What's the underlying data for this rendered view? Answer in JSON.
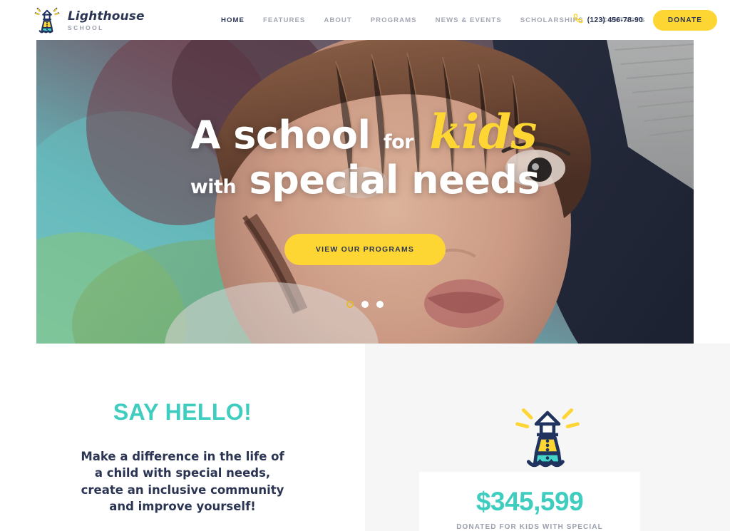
{
  "brand": {
    "name": "Lighthouse",
    "subtitle": "SCHOOL",
    "logo_icon": "lighthouse-icon"
  },
  "nav": {
    "items": [
      {
        "label": "HOME",
        "active": true
      },
      {
        "label": "FEATURES",
        "active": false
      },
      {
        "label": "ABOUT",
        "active": false
      },
      {
        "label": "PROGRAMS",
        "active": false
      },
      {
        "label": "NEWS & EVENTS",
        "active": false
      },
      {
        "label": "SCHOLARSHIPS",
        "active": false
      },
      {
        "label": "CONTACTS",
        "active": false
      }
    ]
  },
  "header_right": {
    "phone_icon": "phone-icon",
    "phone": "(123) 456-78-90",
    "donate_label": "DONATE"
  },
  "hero": {
    "line1_a": "A school",
    "line1_for": "for",
    "line1_highlight": "kids",
    "line2_with": "with",
    "line2_b": "special needs",
    "cta_label": "VIEW OUR PROGRAMS",
    "slides": [
      {
        "active": true
      },
      {
        "active": false
      },
      {
        "active": false
      }
    ]
  },
  "intro": {
    "heading": "SAY HELLO!",
    "body": "Make a difference in the life of a child with special needs, create an inclusive community and improve yourself!"
  },
  "donation": {
    "illustration_icon": "lighthouse-icon",
    "amount": "$345,599",
    "caption": "DONATED FOR KIDS WITH SPECIAL"
  },
  "colors": {
    "yellow": "#fdd634",
    "navy": "#2b3553",
    "teal": "#3fcdc0",
    "muted": "#9aa0ad",
    "panel": "#f6f6f7"
  }
}
